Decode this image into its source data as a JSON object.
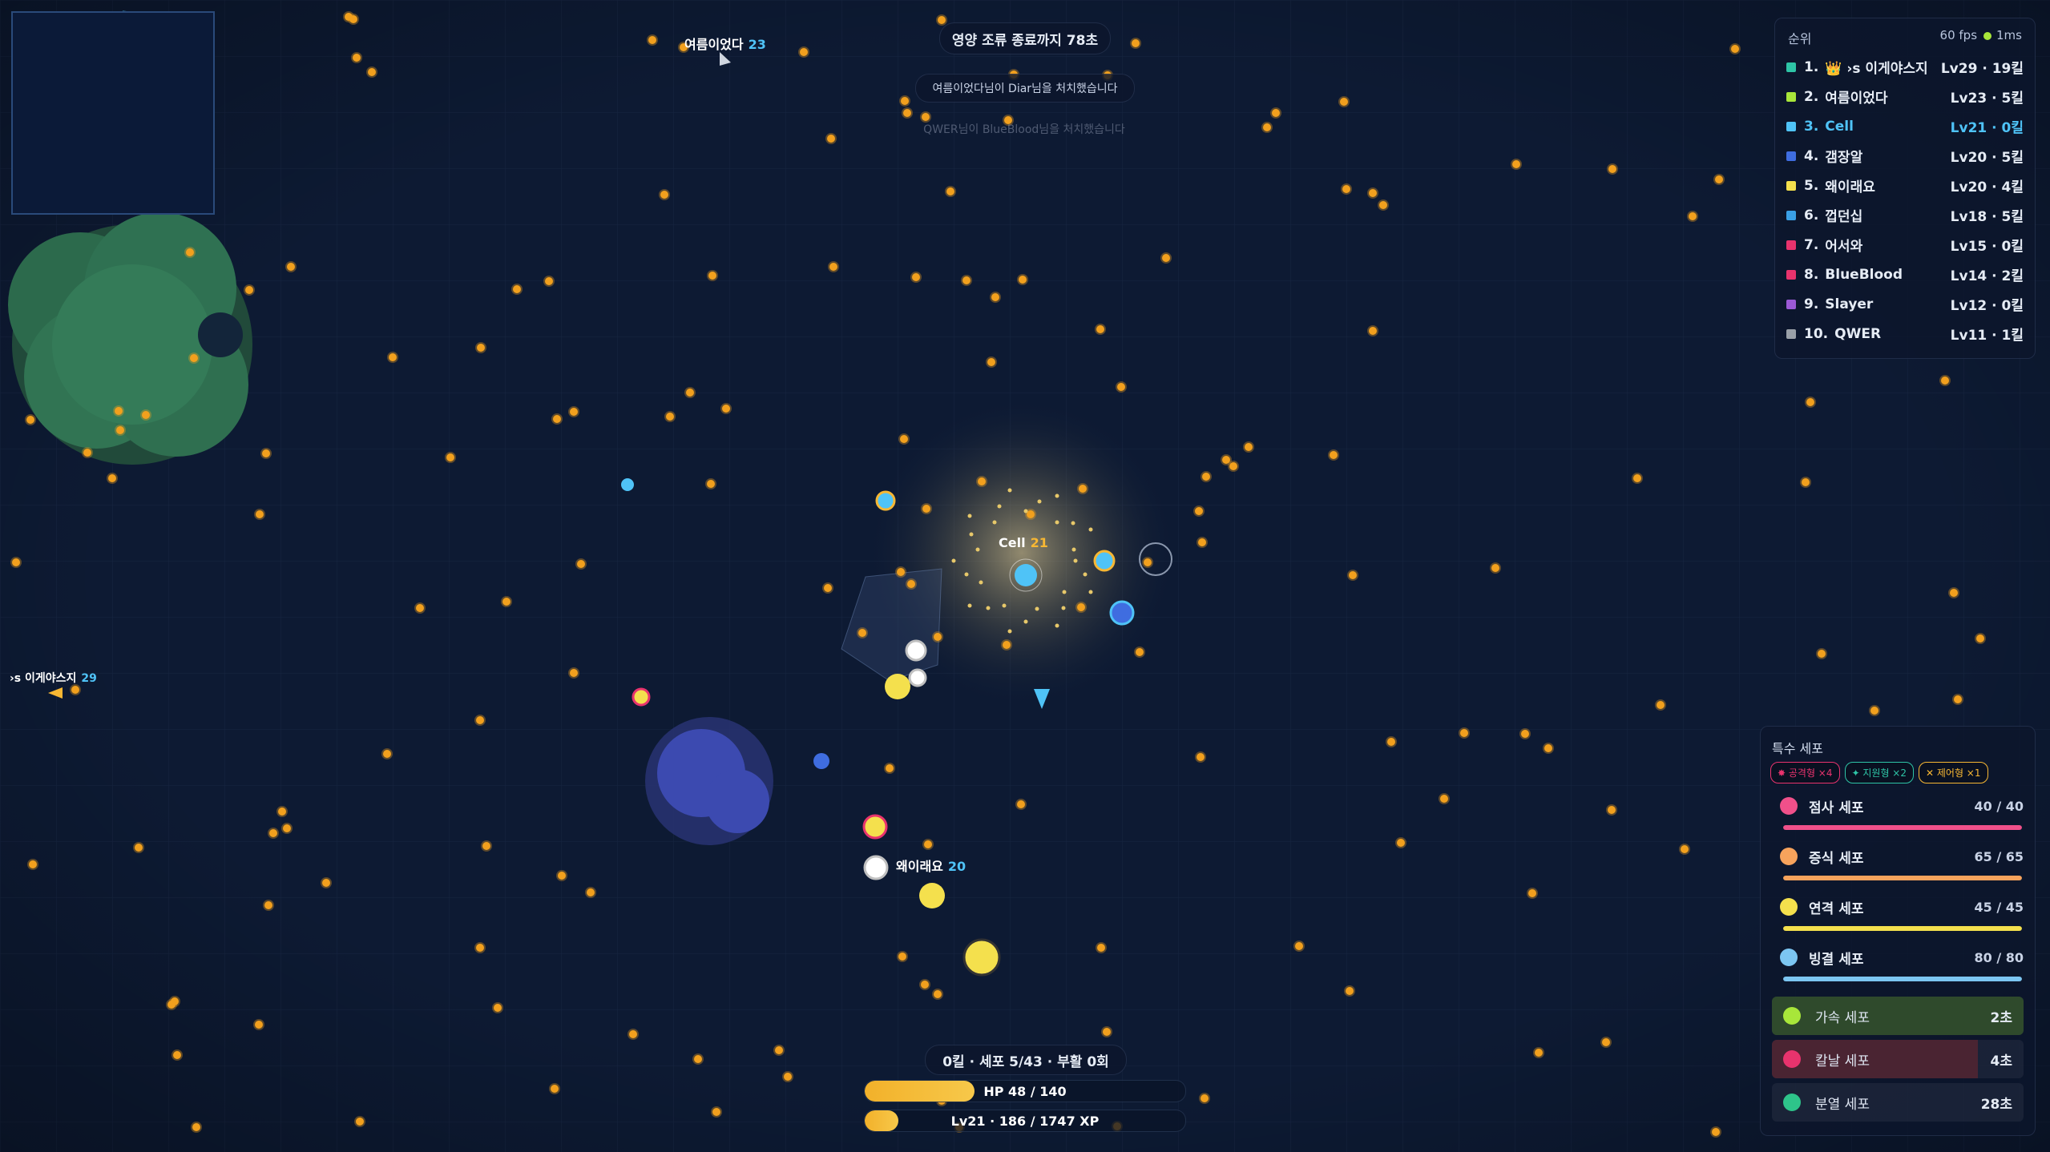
{
  "countdown": "영양 조류 종료까지 78초",
  "killfeed": [
    "여름이었다님이 Diar님을 처치했습니다",
    "QWER님이 BlueBlood님을 처치했습니다"
  ],
  "leaderboard": {
    "title": "순위",
    "fps": "60 fps",
    "ping": "1ms",
    "entries": [
      {
        "rank": "1.",
        "name": "👑 ›s 이게야스지",
        "stat": "Lv29 · 19킬",
        "color": "#2ec4a6"
      },
      {
        "rank": "2.",
        "name": "여름이었다",
        "stat": "Lv23 · 5킬",
        "color": "#a8e63a"
      },
      {
        "rank": "3.",
        "name": "Cell",
        "stat": "Lv21 · 0킬",
        "color": "#4fc3f7",
        "me": true
      },
      {
        "rank": "4.",
        "name": "갬장알",
        "stat": "Lv20 · 5킬",
        "color": "#3f6de0"
      },
      {
        "rank": "5.",
        "name": "왜이래요",
        "stat": "Lv20 · 4킬",
        "color": "#f4e04d"
      },
      {
        "rank": "6.",
        "name": "껍던십",
        "stat": "Lv18 · 5킬",
        "color": "#3aa0e6"
      },
      {
        "rank": "7.",
        "name": "어서와",
        "stat": "Lv15 · 0킬",
        "color": "#e8336d"
      },
      {
        "rank": "8.",
        "name": "BlueBlood",
        "stat": "Lv14 · 2킬",
        "color": "#e8336d"
      },
      {
        "rank": "9.",
        "name": "Slayer",
        "stat": "Lv12 · 0킬",
        "color": "#9b59d6"
      },
      {
        "rank": "10.",
        "name": "QWER",
        "stat": "Lv11 · 1킬",
        "color": "#9aa0a8"
      }
    ]
  },
  "players": {
    "self": {
      "name": "Cell",
      "level": "21"
    },
    "p1": {
      "name": "여름이었다",
      "level": "23"
    },
    "p2": {
      "name": "왜이래요",
      "level": "20"
    },
    "p3": {
      "name": "›s 이게야스지",
      "level": "29"
    }
  },
  "status": {
    "line": "0킬 · 세포 5/43 · 부활 0회",
    "hp": "HP 48 / 140",
    "hp_fraction": 0.343,
    "xp": "Lv21 · 186 / 1747 XP",
    "xp_fraction": 0.106
  },
  "special": {
    "title": "특수 세포",
    "chips": [
      {
        "label": "✸ 공격형 ×4",
        "color": "#e8336d"
      },
      {
        "label": "✦ 지원형 ×2",
        "color": "#2ec4a6"
      },
      {
        "label": "✕ 제어형 ×1",
        "color": "#f7b733"
      }
    ],
    "cells": [
      {
        "name": "점사 세포",
        "value": "40 / 40",
        "fraction": 1.0,
        "color": "#f0508a"
      },
      {
        "name": "증식 세포",
        "value": "65 / 65",
        "fraction": 1.0,
        "color": "#f7a35c"
      },
      {
        "name": "연격 세포",
        "value": "45 / 45",
        "fraction": 1.0,
        "color": "#f4e04d"
      },
      {
        "name": "빙결 세포",
        "value": "80 / 80",
        "fraction": 1.0,
        "color": "#7cc6f2"
      }
    ],
    "cooldowns": [
      {
        "name": "가속 세포",
        "time": "2초",
        "fraction": 1.0,
        "color": "#a8e63a",
        "bg": "#2f4a2c"
      },
      {
        "name": "칼날 세포",
        "time": "4초",
        "fraction": 0.82,
        "color": "#e8336d",
        "bg": "#4a2432"
      },
      {
        "name": "분열 세포",
        "time": "28초",
        "fraction": 0.0,
        "color": "#2ec48a",
        "bg": "#1f3a34"
      }
    ]
  }
}
